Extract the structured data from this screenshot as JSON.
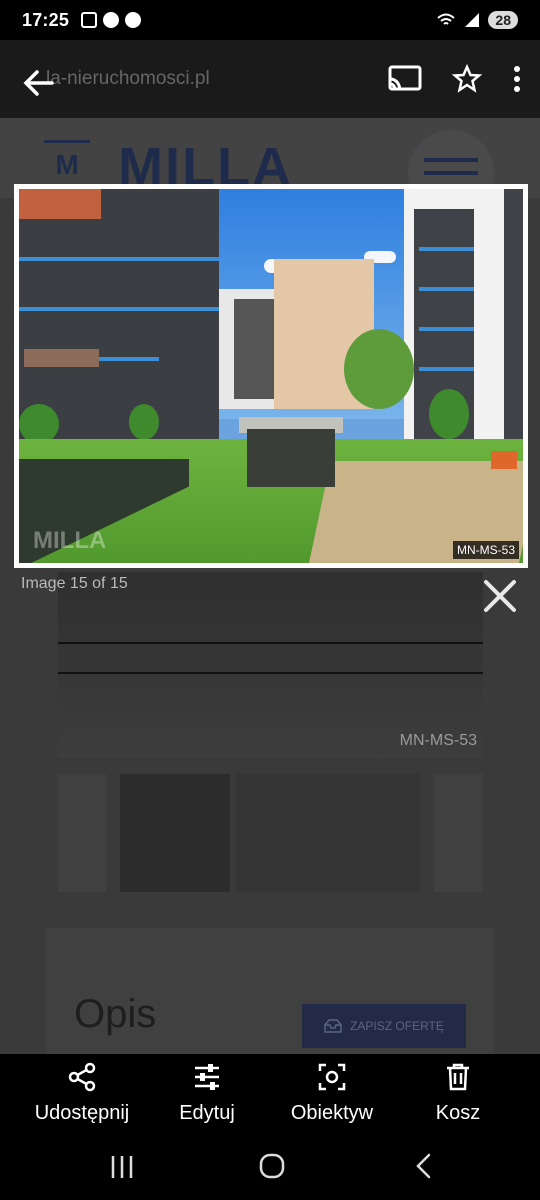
{
  "status": {
    "time": "17:25",
    "battery": "28"
  },
  "browser": {
    "url": "la-nieruchomosci.pl"
  },
  "page": {
    "logo": "MILLA",
    "logo_mark": "M",
    "section_title": "Opis",
    "save_offer_label": "ZAPISZ OFERTĘ",
    "bg_photo_tag": "MN-MS-53"
  },
  "viewer": {
    "photo_tag": "MN-MS-53",
    "counter": "Image 15 of 15",
    "watermark": "MILLA"
  },
  "actions": [
    {
      "label": "Udostępnij",
      "icon": "share-icon"
    },
    {
      "label": "Edytuj",
      "icon": "sliders-icon"
    },
    {
      "label": "Obiektyw",
      "icon": "lens-icon"
    },
    {
      "label": "Kosz",
      "icon": "trash-icon"
    }
  ],
  "nav": [
    "recents-icon",
    "home-icon",
    "back-icon"
  ]
}
